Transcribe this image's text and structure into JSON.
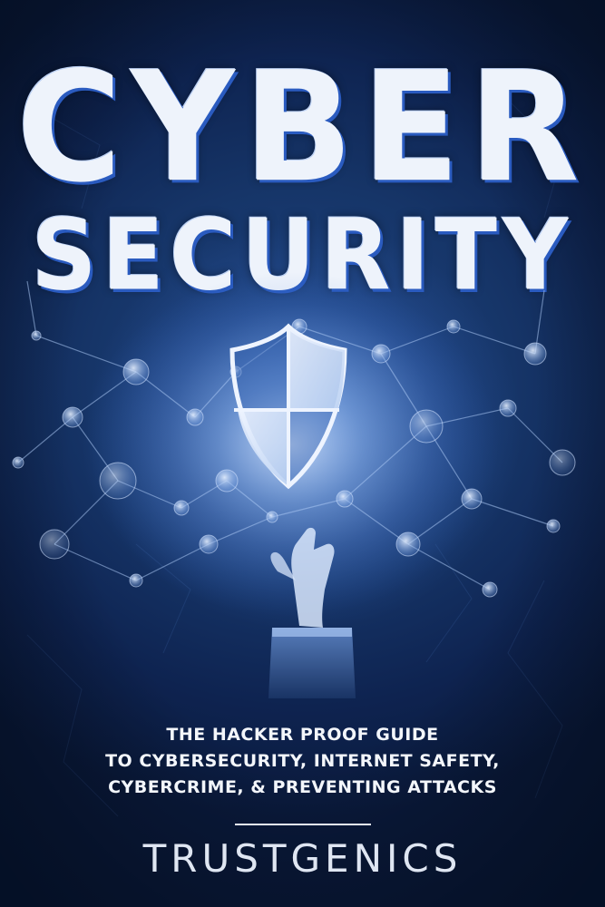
{
  "cover": {
    "title_line_1": "CYBER",
    "title_line_2": "SECURITY",
    "subtitle_lines": [
      "THE HACKER PROOF GUIDE",
      "TO CYBERSECURITY, INTERNET SAFETY,",
      "CYBERCRIME, & PREVENTING ATTACKS"
    ],
    "author": "TRUSTGENICS"
  },
  "colors": {
    "background": "#163568",
    "title_text": "#eef3fb",
    "title_shadow": "#2a5bc0",
    "glow": "#9cc3ff"
  },
  "icons": {
    "shield": "shield-icon",
    "hand": "hand-icon"
  }
}
